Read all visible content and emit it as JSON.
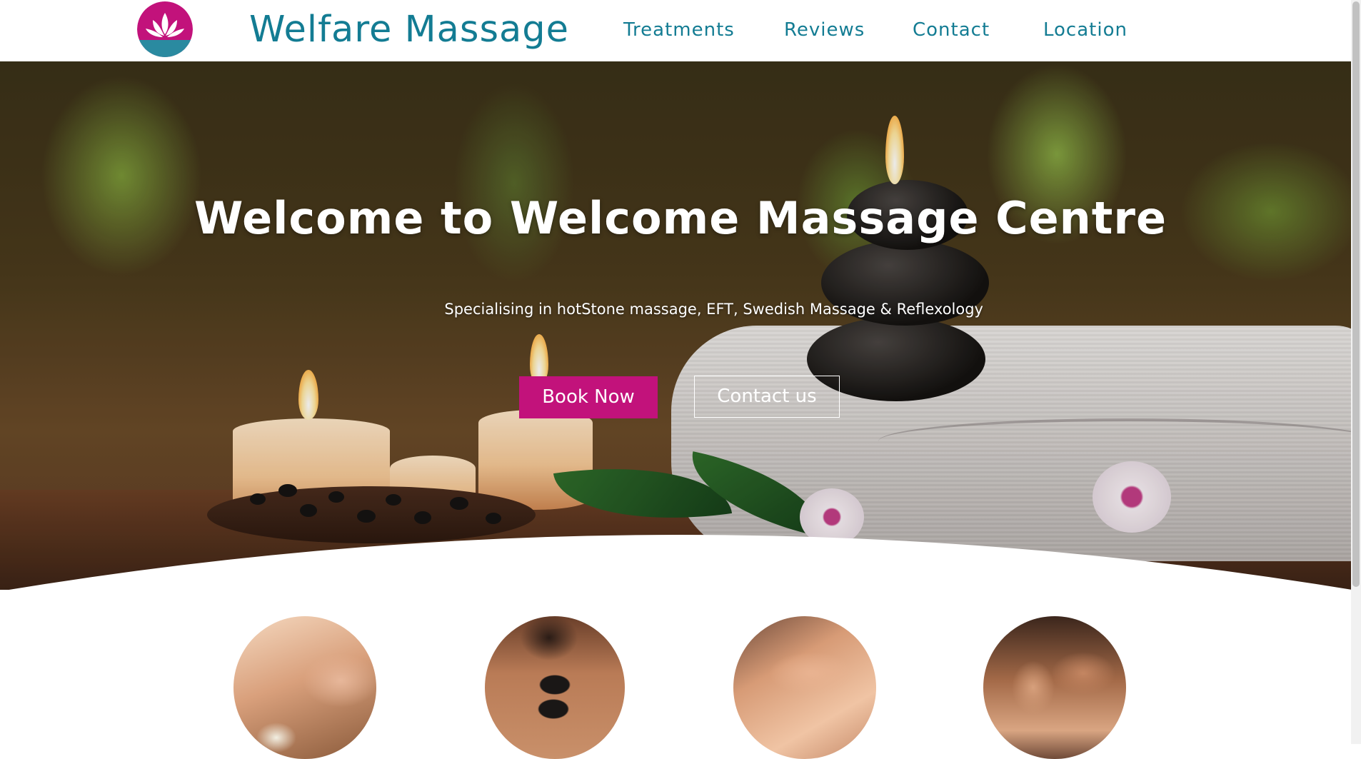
{
  "header": {
    "logo_icon": "lotus-logo-icon",
    "site_title": "Welfare Massage",
    "nav": [
      {
        "label": "Treatments"
      },
      {
        "label": "Reviews"
      },
      {
        "label": "Contact"
      },
      {
        "label": "Location"
      }
    ]
  },
  "hero": {
    "title": "Welcome to Welcome Massage Centre",
    "subtitle": "Specialising in hotStone massage, EFT, Swedish Massage & Reflexology",
    "book_button": "Book Now",
    "contact_button": "Contact us"
  },
  "treatments": [
    {
      "image": "herbal-compress-massage-image"
    },
    {
      "image": "hot-stone-massage-image"
    },
    {
      "image": "back-massage-hands-image"
    },
    {
      "image": "relaxing-shoulder-massage-image"
    }
  ],
  "colors": {
    "brand_teal": "#137c93",
    "accent_magenta": "#c2127b",
    "background": "#ffffff"
  }
}
